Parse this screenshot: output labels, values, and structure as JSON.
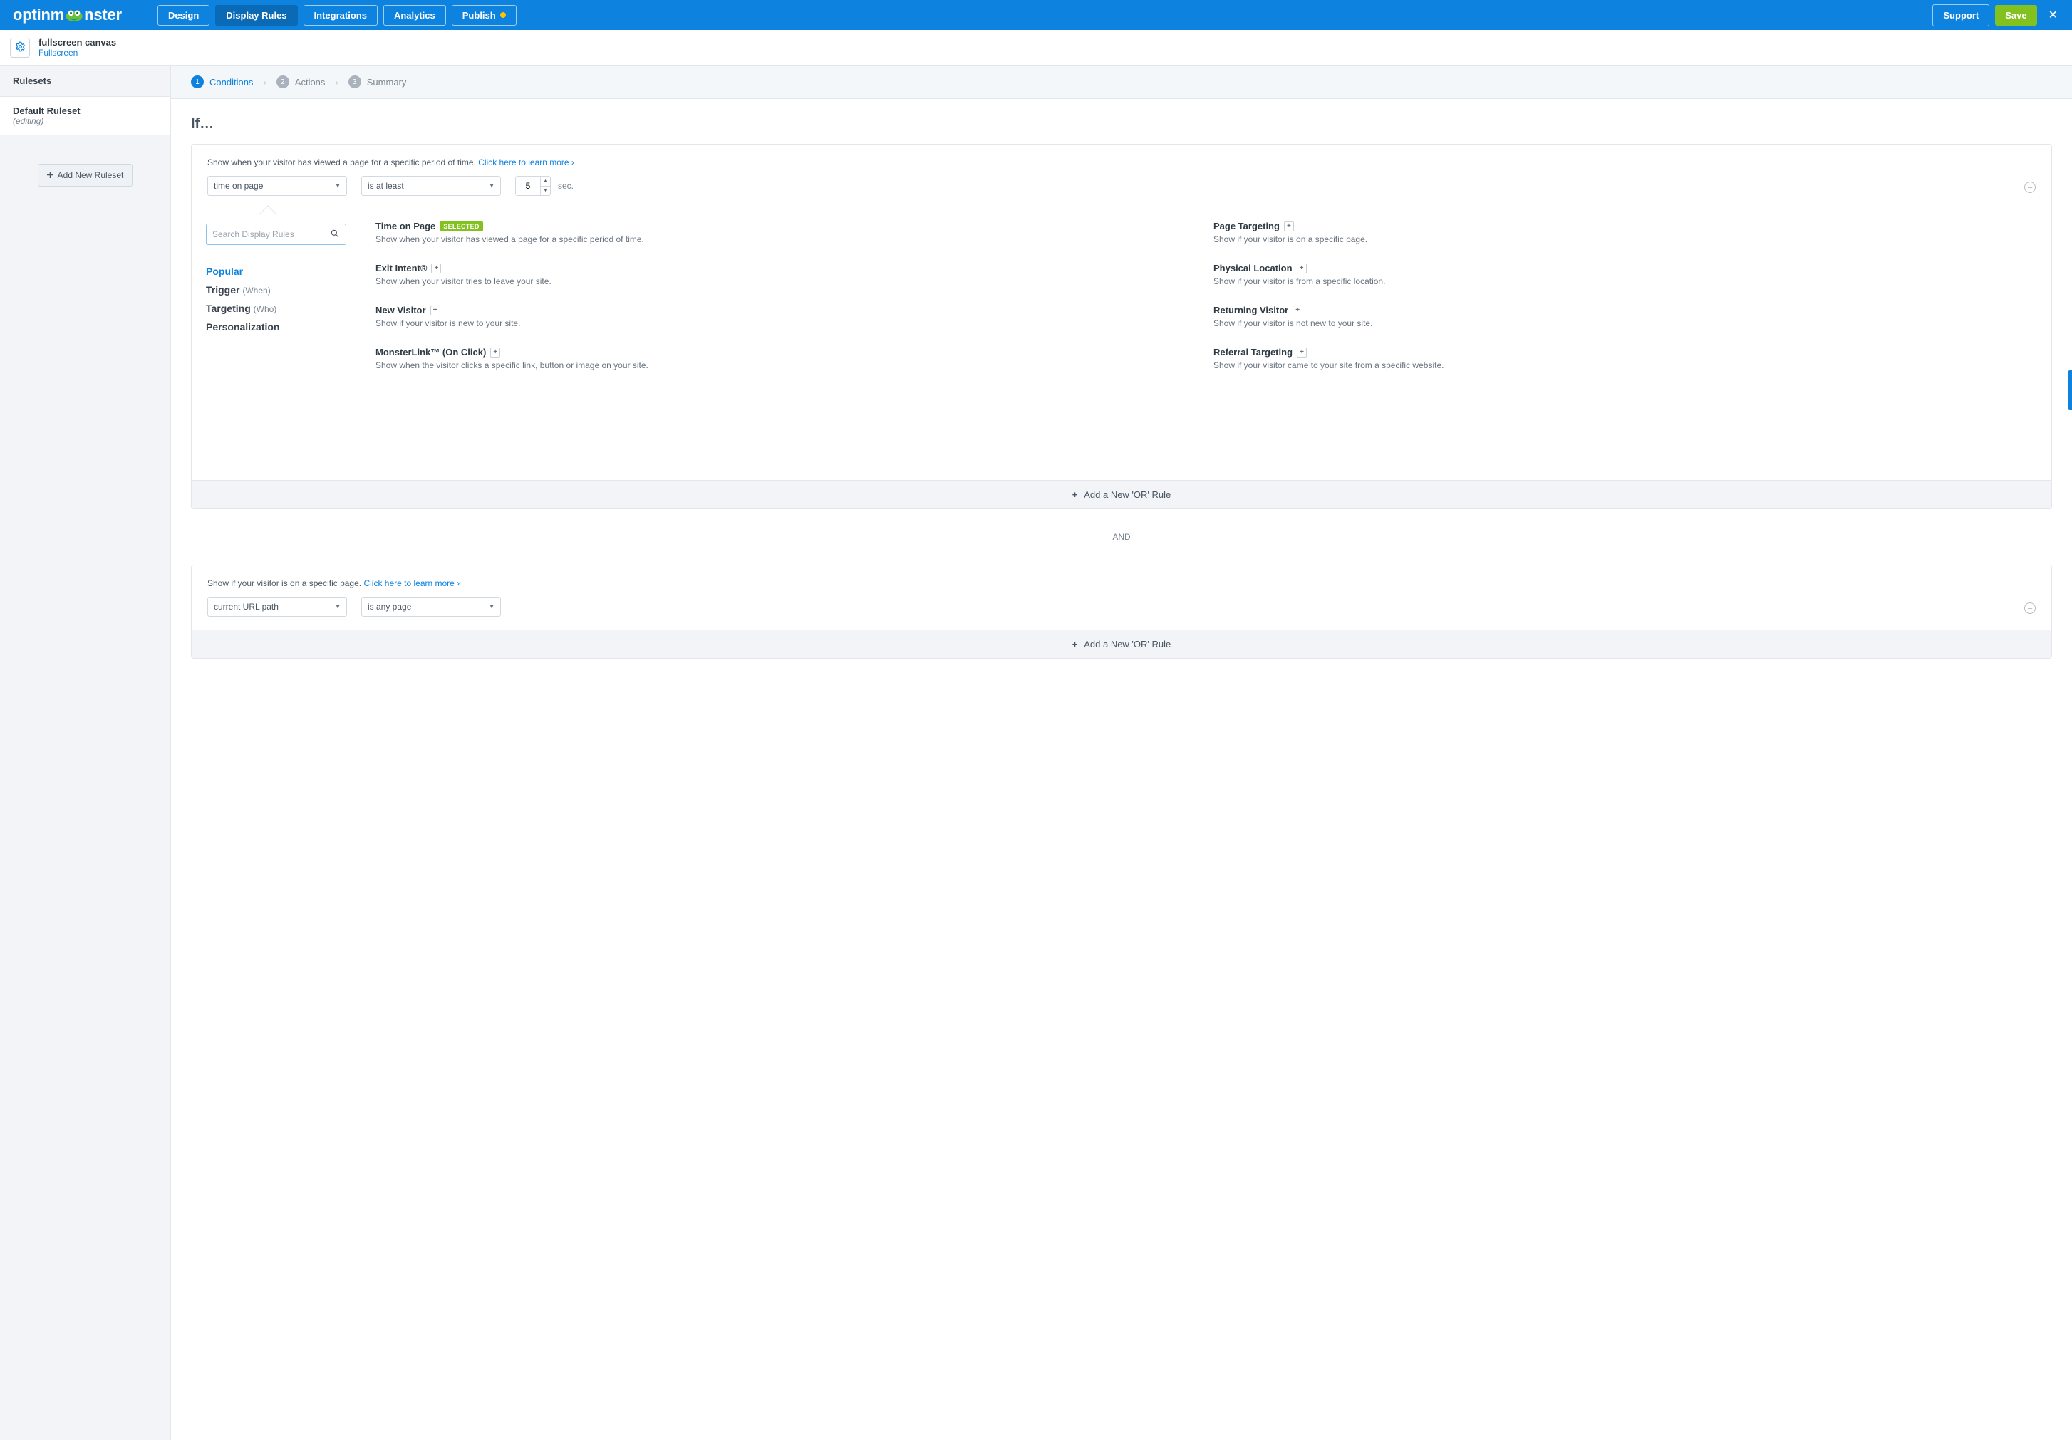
{
  "brand": "optinmonster",
  "topnav": {
    "design": "Design",
    "display_rules": "Display Rules",
    "integrations": "Integrations",
    "analytics": "Analytics",
    "publish": "Publish"
  },
  "top_right": {
    "support": "Support",
    "save": "Save"
  },
  "campaign": {
    "name": "fullscreen canvas",
    "type": "Fullscreen"
  },
  "sidebar": {
    "header": "Rulesets",
    "ruleset": {
      "title": "Default Ruleset",
      "state": "(editing)"
    },
    "add_btn": "Add New Ruleset"
  },
  "wizard": {
    "s1": "Conditions",
    "s2": "Actions",
    "s3": "Summary",
    "n1": "1",
    "n2": "2",
    "n3": "3"
  },
  "if_label": "If…",
  "rule1": {
    "desc": "Show when your visitor has viewed a page for a specific period of time.",
    "learn": "Click here to learn more",
    "select_a": "time on page",
    "select_b": "is at least",
    "number": "5",
    "unit": "sec."
  },
  "search": {
    "placeholder": "Search Display Rules"
  },
  "categories": {
    "popular": "Popular",
    "trigger": "Trigger",
    "trigger_sub": "(When)",
    "targeting": "Targeting",
    "targeting_sub": "(Who)",
    "personalization": "Personalization"
  },
  "badge_selected": "SELECTED",
  "catalog": {
    "time_on_page": {
      "title": "Time on Page",
      "desc": "Show when your visitor has viewed a page for a specific period of time."
    },
    "page_targeting": {
      "title": "Page Targeting",
      "desc": "Show if your visitor is on a specific page."
    },
    "exit_intent": {
      "title": "Exit Intent®",
      "desc": "Show when your visitor tries to leave your site."
    },
    "physical_location": {
      "title": "Physical Location",
      "desc": "Show if your visitor is from a specific location."
    },
    "new_visitor": {
      "title": "New Visitor",
      "desc": "Show if your visitor is new to your site."
    },
    "returning_visitor": {
      "title": "Returning Visitor",
      "desc": "Show if your visitor is not new to your site."
    },
    "monsterlink": {
      "title": "MonsterLink™ (On Click)",
      "desc": "Show when the visitor clicks a specific link, button or image on your site."
    },
    "referral_targeting": {
      "title": "Referral Targeting",
      "desc": "Show if your visitor came to your site from a specific website."
    }
  },
  "add_or": "Add a New 'OR' Rule",
  "and_label": "AND",
  "rule2": {
    "desc": "Show if your visitor is on a specific page.",
    "learn": "Click here to learn more",
    "select_a": "current URL path",
    "select_b": "is any page"
  }
}
